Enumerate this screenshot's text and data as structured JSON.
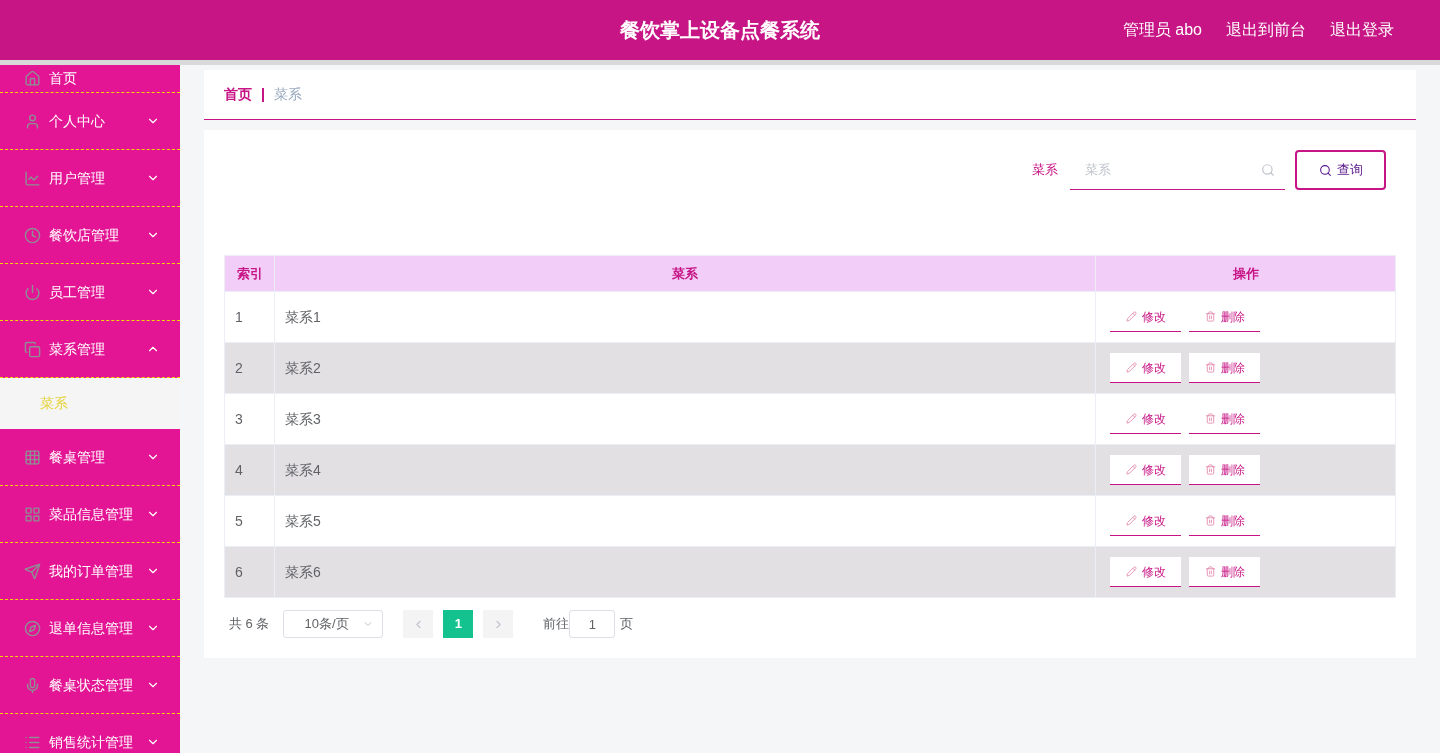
{
  "header": {
    "title": "餐饮掌上设备点餐系统",
    "links": [
      "管理员 abo",
      "退出到前台",
      "退出登录"
    ]
  },
  "sidebar": {
    "items": [
      {
        "label": "首页",
        "expandable": false
      },
      {
        "label": "个人中心",
        "expandable": true,
        "expanded": false
      },
      {
        "label": "用户管理",
        "expandable": true,
        "expanded": false
      },
      {
        "label": "餐饮店管理",
        "expandable": true,
        "expanded": false
      },
      {
        "label": "员工管理",
        "expandable": true,
        "expanded": false
      },
      {
        "label": "菜系管理",
        "expandable": true,
        "expanded": true,
        "children": [
          {
            "label": "菜系",
            "selected": true
          }
        ]
      },
      {
        "label": "餐桌管理",
        "expandable": true,
        "expanded": false
      },
      {
        "label": "菜品信息管理",
        "expandable": true,
        "expanded": false
      },
      {
        "label": "我的订单管理",
        "expandable": true,
        "expanded": false
      },
      {
        "label": "退单信息管理",
        "expandable": true,
        "expanded": false
      },
      {
        "label": "餐桌状态管理",
        "expandable": true,
        "expanded": false
      },
      {
        "label": "销售统计管理",
        "expandable": true,
        "expanded": false
      }
    ]
  },
  "breadcrumb": [
    "首页",
    "菜系"
  ],
  "search": {
    "label": "菜系",
    "placeholder": "菜系",
    "button": "查询"
  },
  "table": {
    "columns": [
      "索引",
      "菜系",
      "操作"
    ],
    "rows": [
      {
        "index": "1",
        "name": "菜系1",
        "actions": [
          "修改",
          "删除"
        ]
      },
      {
        "index": "2",
        "name": "菜系2",
        "actions": [
          "修改",
          "删除"
        ]
      },
      {
        "index": "3",
        "name": "菜系3",
        "actions": [
          "修改",
          "删除"
        ]
      },
      {
        "index": "4",
        "name": "菜系4",
        "actions": [
          "修改",
          "删除"
        ]
      },
      {
        "index": "5",
        "name": "菜系5",
        "actions": [
          "修改",
          "删除"
        ]
      },
      {
        "index": "6",
        "name": "菜系6",
        "actions": [
          "修改",
          "删除"
        ]
      }
    ]
  },
  "pagination": {
    "total": "共 6 条",
    "page_size": "10条/页",
    "pages": [
      {
        "label": "1",
        "selected": true
      }
    ],
    "goto_label": "前往",
    "goto_value": "1",
    "goto_suffix": "页"
  }
}
